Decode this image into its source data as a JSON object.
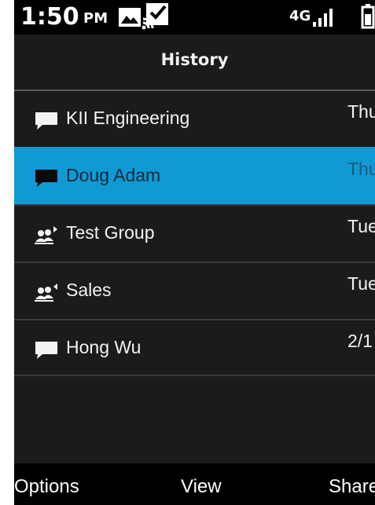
{
  "status_bar": {
    "time": "1:50",
    "ampm": "PM",
    "network": "4G"
  },
  "header": {
    "title": "History"
  },
  "history": [
    {
      "name": "KII Engineering",
      "date": "Thu",
      "icon": "chat-bubble-icon",
      "selected": false
    },
    {
      "name": "Doug Adam",
      "date": "Thu",
      "icon": "chat-bubble-icon",
      "selected": true
    },
    {
      "name": "Test Group",
      "date": "Tue",
      "icon": "group-icon",
      "selected": false
    },
    {
      "name": "Sales",
      "date": "Tue",
      "icon": "group-icon",
      "selected": false
    },
    {
      "name": "Hong Wu",
      "date": "2/1",
      "icon": "chat-bubble-icon",
      "selected": false
    }
  ],
  "softkeys": {
    "left": "Options",
    "center": "View",
    "right": "Share"
  },
  "colors": {
    "selected_bg": "#0f9ad4",
    "background": "#1b1b1b",
    "text": "#f3f3f3"
  }
}
